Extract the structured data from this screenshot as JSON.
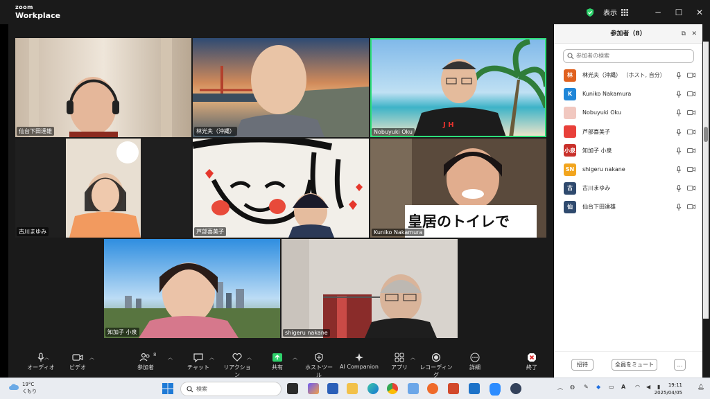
{
  "titlebar": {
    "brand_top": "zoom",
    "brand_bottom": "Workplace",
    "view_label": "表示"
  },
  "tiles": [
    {
      "name": "仙台下田達雄"
    },
    {
      "name": "林光夫（沖縄）"
    },
    {
      "name": "Nobuyuki Oku"
    },
    {
      "name": "古川まゆみ"
    },
    {
      "name": "芦部喜美子"
    },
    {
      "name": "Kuniko Nakamura",
      "sign_text": "皇居のトイレで"
    },
    {
      "name": "知加子 小泉"
    },
    {
      "name": "shigeru nakane"
    }
  ],
  "toolbar": {
    "audio": "オーディオ",
    "video": "ビデオ",
    "participants": "参加者",
    "participants_count": "8",
    "chat": "チャット",
    "reactions": "リアクション",
    "share": "共有",
    "host_tools": "ホストツール",
    "ai_companion": "AI Companion",
    "apps": "アプリ",
    "recording": "レコーディング",
    "more": "詳細",
    "end": "終了"
  },
  "panel": {
    "title": "参加者（8）",
    "search_placeholder": "参加者の検索",
    "participants": [
      {
        "initial": "林",
        "color": "#e0611f",
        "name": "林光夫（沖縄）",
        "role": "（ホスト, 自分）"
      },
      {
        "initial": "K",
        "color": "#1f86d8",
        "name": "Kuniko Nakamura",
        "role": ""
      },
      {
        "initial": "",
        "color": "#f1c8c0",
        "name": "Nobuyuki Oku",
        "role": ""
      },
      {
        "initial": "",
        "color": "#e8403a",
        "name": "芦部喜美子",
        "role": ""
      },
      {
        "initial": "小泉",
        "color": "#c9302a",
        "name": "知加子 小泉",
        "role": ""
      },
      {
        "initial": "SN",
        "color": "#f2a51e",
        "name": "shigeru nakane",
        "role": ""
      },
      {
        "initial": "古",
        "color": "#2f4a6e",
        "name": "古川まゆみ",
        "role": ""
      },
      {
        "initial": "仙",
        "color": "#2f4a6e",
        "name": "仙台下田達雄",
        "role": ""
      }
    ],
    "invite": "招待",
    "mute_all": "全員をミュート",
    "more": "…"
  },
  "taskbar": {
    "temp": "19°C",
    "condition": "くもり",
    "search": "検索",
    "time": "19:11",
    "date": "2025/04/05"
  }
}
